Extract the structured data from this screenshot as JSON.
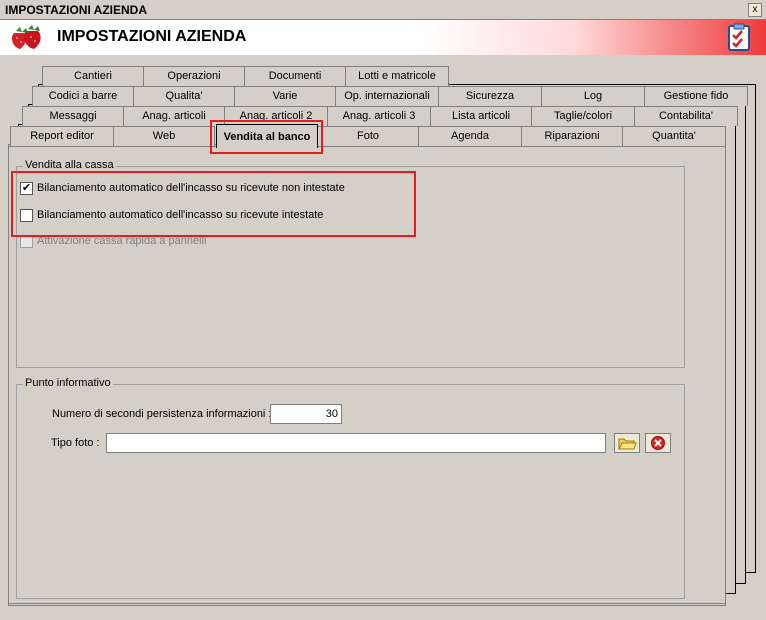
{
  "window": {
    "title": "IMPOSTAZIONI AZIENDA",
    "close_glyph": "x"
  },
  "header": {
    "title": "IMPOSTAZIONI AZIENDA",
    "logo_icon": "strawberries-icon",
    "clipboard_icon": "checklist-icon"
  },
  "tabs": {
    "row1": [
      "Cantieri",
      "Operazioni",
      "Documenti",
      "Lotti e matricole"
    ],
    "row2": [
      "Codici a barre",
      "Qualita'",
      "Varie",
      "Op. internazionali",
      "Sicurezza",
      "Log",
      "Gestione fido"
    ],
    "row3": [
      "Messaggi",
      "Anag. articoli",
      "Anag. articoli 2",
      "Anag. articoli 3",
      "Lista articoli",
      "Taglie/colori",
      "Contabilita'"
    ],
    "row4": [
      "Report editor",
      "Web",
      "Vendita al banco",
      "Foto",
      "Agenda",
      "Riparazioni",
      "Quantita'"
    ],
    "active": "Vendita al banco"
  },
  "vendita": {
    "legend": "Vendita alla cassa",
    "opt1": "Bilanciamento automatico dell'incasso su ricevute non intestate",
    "opt1_checked": true,
    "opt2": "Bilanciamento automatico dell'incasso su ricevute intestate",
    "opt2_checked": false,
    "opt3": "Attivazione cassa rapida a pannelli",
    "opt3_checked": false,
    "check_glyph": "✔"
  },
  "punto": {
    "legend": "Punto informativo",
    "secondi_label": "Numero di secondi persistenza informazioni :",
    "secondi_value": "30",
    "foto_label": "Tipo foto :",
    "foto_value": ""
  },
  "colors": {
    "highlight": "#e81c1c",
    "header_red": "#ee3a3a"
  }
}
